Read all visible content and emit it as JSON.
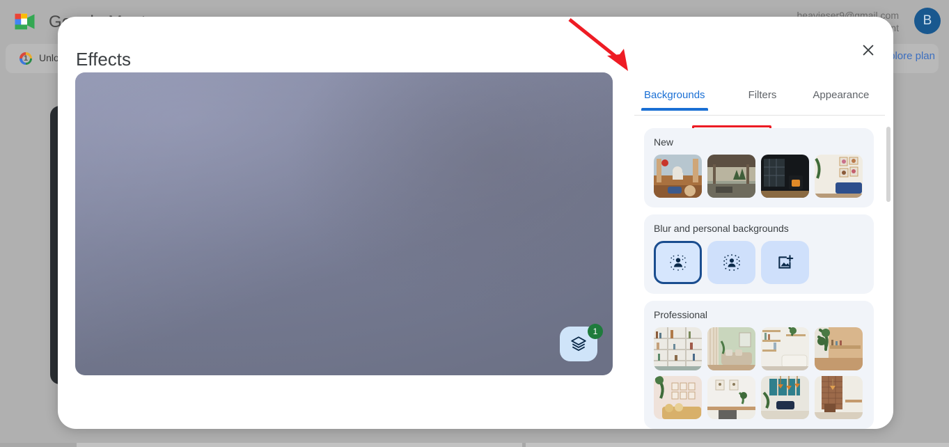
{
  "background_page": {
    "app_name": "Google Meet",
    "logo_icon": "google-meet-logo",
    "account_email": "heavieser9@gmail.com",
    "account_sub": "Switch account",
    "avatar_initial": "B",
    "banner": {
      "icon": "google-one-icon",
      "text": "Unlock premium Google Meet features",
      "cta": "Explore plan"
    }
  },
  "dialog": {
    "title": "Effects",
    "close_icon": "close-icon",
    "preview": {
      "label": "self-view-video-preview",
      "layers_icon": "layers-icon",
      "layers_badge": "1"
    },
    "tabs": [
      {
        "label": "Backgrounds",
        "active": true
      },
      {
        "label": "Filters",
        "active": false
      },
      {
        "label": "Appearance",
        "active": false
      }
    ],
    "sections": [
      {
        "title": "New",
        "items": [
          {
            "name": "taj-mahal-terrace-background"
          },
          {
            "name": "pergola-patio-background"
          },
          {
            "name": "dark-room-fireplace-background"
          },
          {
            "name": "gallery-wall-blue-sofa-background"
          }
        ]
      },
      {
        "title": "Blur and personal backgrounds",
        "options": [
          {
            "name": "slight-blur-option",
            "icon": "person-slight-blur-icon",
            "selected": true
          },
          {
            "name": "full-blur-option",
            "icon": "person-full-blur-icon",
            "selected": false
          },
          {
            "name": "upload-image-option",
            "icon": "add-image-icon",
            "selected": false
          }
        ]
      },
      {
        "title": "Professional",
        "items": [
          {
            "name": "bookshelf-background"
          },
          {
            "name": "green-wall-sofa-background"
          },
          {
            "name": "shelves-plant-sofa-background"
          },
          {
            "name": "wood-wall-plant-background"
          },
          {
            "name": "pink-wall-frames-sofa-background"
          },
          {
            "name": "white-desk-frames-background"
          },
          {
            "name": "teal-office-pendants-background"
          },
          {
            "name": "brick-wall-dining-background"
          }
        ]
      }
    ],
    "scrollbar": {
      "name": "panel-scrollbar"
    }
  },
  "annotations": {
    "arrow": "red-arrow-pointing-to-backgrounds-tab",
    "highlight": "red-highlight-box-around-backgrounds-tab"
  }
}
